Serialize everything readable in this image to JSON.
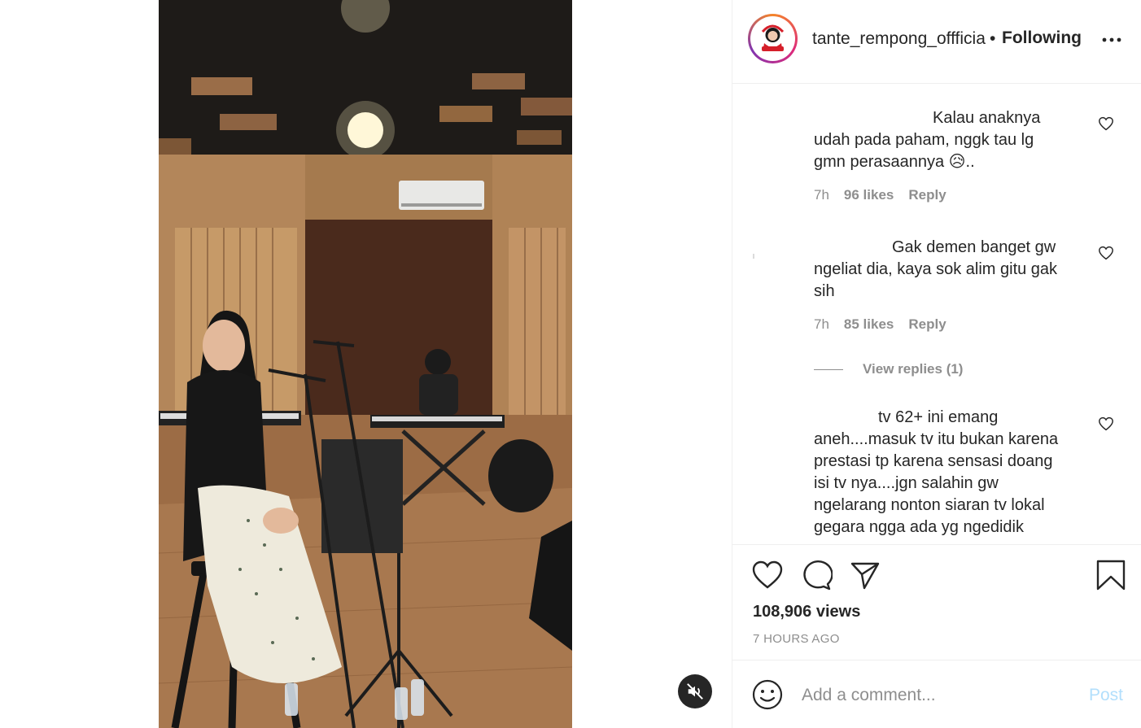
{
  "post": {
    "username": "tante_rempong_offficial",
    "separator": "•",
    "follow_status": "Following",
    "more_icon": "more-horizontal-icon"
  },
  "comments": [
    {
      "line1": "Kalau anaknya",
      "line2": "udah pada paham, nggk tau lg",
      "line3": "gmn perasaannya",
      "emoji": "😥",
      "trail": "..",
      "time": "7h",
      "likes": "96 likes",
      "reply": "Reply"
    },
    {
      "line1": "Gak demen banget gw",
      "line2": "ngeliat dia, kaya sok alim gitu gak",
      "line3": "sih",
      "time": "7h",
      "likes": "85 likes",
      "reply": "Reply",
      "view_replies": "View replies (1)"
    },
    {
      "line1": "tv 62+ ini emang",
      "line2": "aneh....masuk tv itu bukan karena",
      "line3": "prestasi tp karena sensasi doang",
      "line4": "isi tv nya....jgn salahin gw",
      "line5": "ngelarang nonton siaran tv lokal",
      "line6": "gegara ngga ada yg ngedidik"
    }
  ],
  "actions": {
    "views": "108,906 views",
    "time_ago": "7 HOURS AGO"
  },
  "add_comment": {
    "placeholder": "Add a comment...",
    "post_label": "Post"
  },
  "colors": {
    "text": "#262626",
    "secondary": "#8e8e8e",
    "border": "#efefef",
    "post_disabled": "#b2dffc"
  }
}
